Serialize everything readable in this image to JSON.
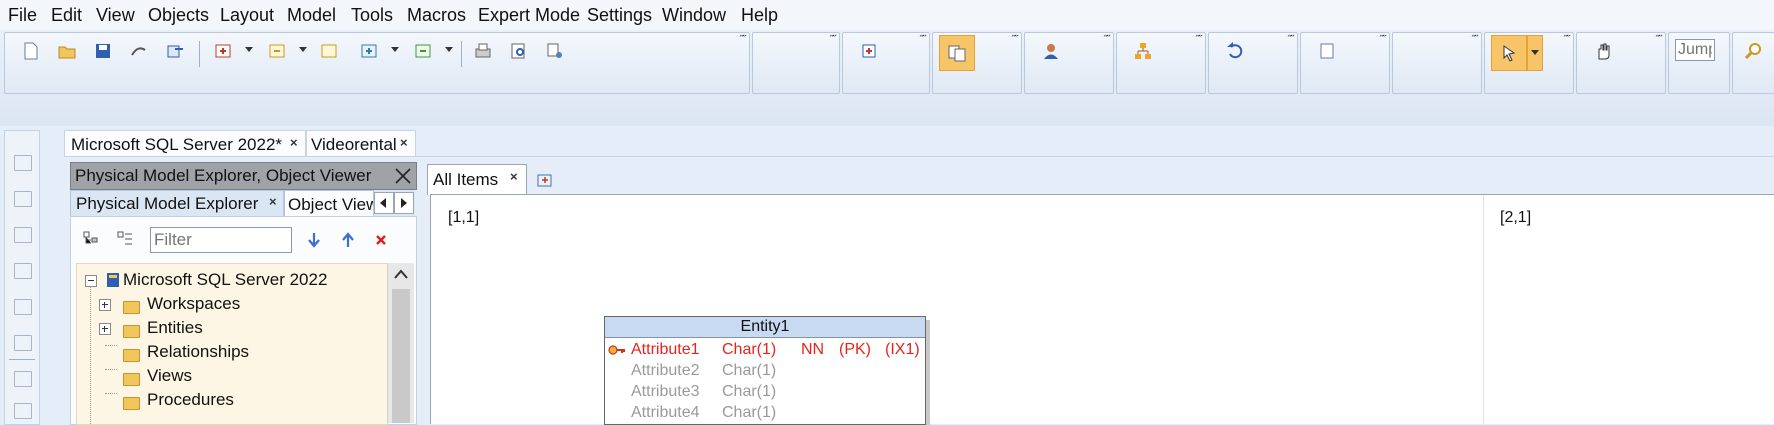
{
  "menu": [
    "File",
    "Edit",
    "View",
    "Objects",
    "Layout",
    "Model",
    "Tools",
    "Macros",
    "Expert Mode",
    "Settings",
    "Window",
    "Help"
  ],
  "toolbar": {
    "jump_placeholder": "Jump"
  },
  "doc_tabs": [
    {
      "label": "Microsoft SQL Server 2022*",
      "close": "×"
    },
    {
      "label": "Videorental",
      "close": "×"
    }
  ],
  "explorer": {
    "header": "Physical Model Explorer, Object Viewer",
    "tabs": [
      {
        "label": "Physical Model Explorer",
        "close": "×"
      },
      {
        "label": "Object View"
      }
    ],
    "filter_placeholder": "Filter",
    "tree": {
      "root": "Microsoft SQL Server 2022",
      "children": [
        "Workspaces",
        "Entities",
        "Relationships",
        "Views",
        "Procedures"
      ]
    }
  },
  "diagram": {
    "tab": {
      "label": "All Items",
      "close": "×"
    },
    "cells": [
      "[1,1]",
      "[2,1]"
    ],
    "entity": {
      "title": "Entity1",
      "attributes": [
        {
          "name": "Attribute1",
          "type": "Char(1)",
          "nn": "NN",
          "pk": "(PK)",
          "ix": "(IX1)",
          "key": true
        },
        {
          "name": "Attribute2",
          "type": "Char(1)"
        },
        {
          "name": "Attribute3",
          "type": "Char(1)"
        },
        {
          "name": "Attribute4",
          "type": "Char(1)"
        }
      ]
    }
  },
  "colors": {
    "key_attribute": "#e8231c",
    "normal_attribute": "#9a9a9a",
    "highlight": "#f8c468",
    "entity_header": "#c7daf1"
  }
}
